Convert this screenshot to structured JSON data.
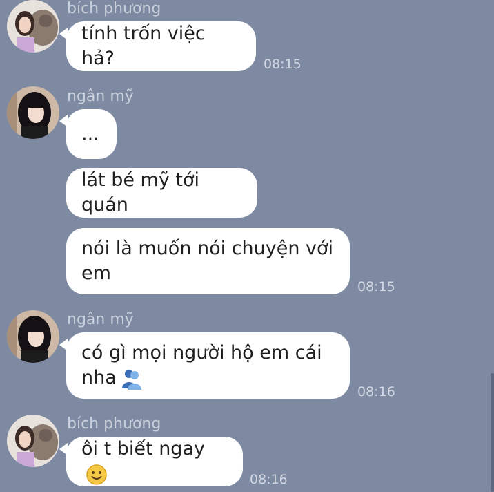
{
  "messages": [
    {
      "sender": "bích phương",
      "avatar": "avatar-girl-with-cat",
      "bubbles": [
        "tính trốn việc hả?"
      ],
      "time": "08:15"
    },
    {
      "sender": "ngân mỹ",
      "avatar": "avatar-girl-dark-hair",
      "bubbles": [
        "...",
        "lát bé mỹ tới quán",
        "nói là muốn nói chuyện với\nem"
      ],
      "time": "08:15"
    },
    {
      "sender": "ngân mỹ",
      "avatar": "avatar-girl-dark-hair",
      "bubbles": [
        "có gì mọi người hộ em cái\nnha"
      ],
      "emoji": "hugging-people-emoji",
      "time": "08:16"
    },
    {
      "sender": "bích phương",
      "avatar": "avatar-girl-with-cat",
      "bubbles": [
        "ôi t biết ngay"
      ],
      "emoji": "slightly-smiling-face-emoji",
      "time": "08:16"
    }
  ],
  "colors": {
    "background": "#7d8aa2",
    "bubble": "#ffffff",
    "sender_text": "#c9d0dc",
    "time_text": "#d3d8e2"
  }
}
